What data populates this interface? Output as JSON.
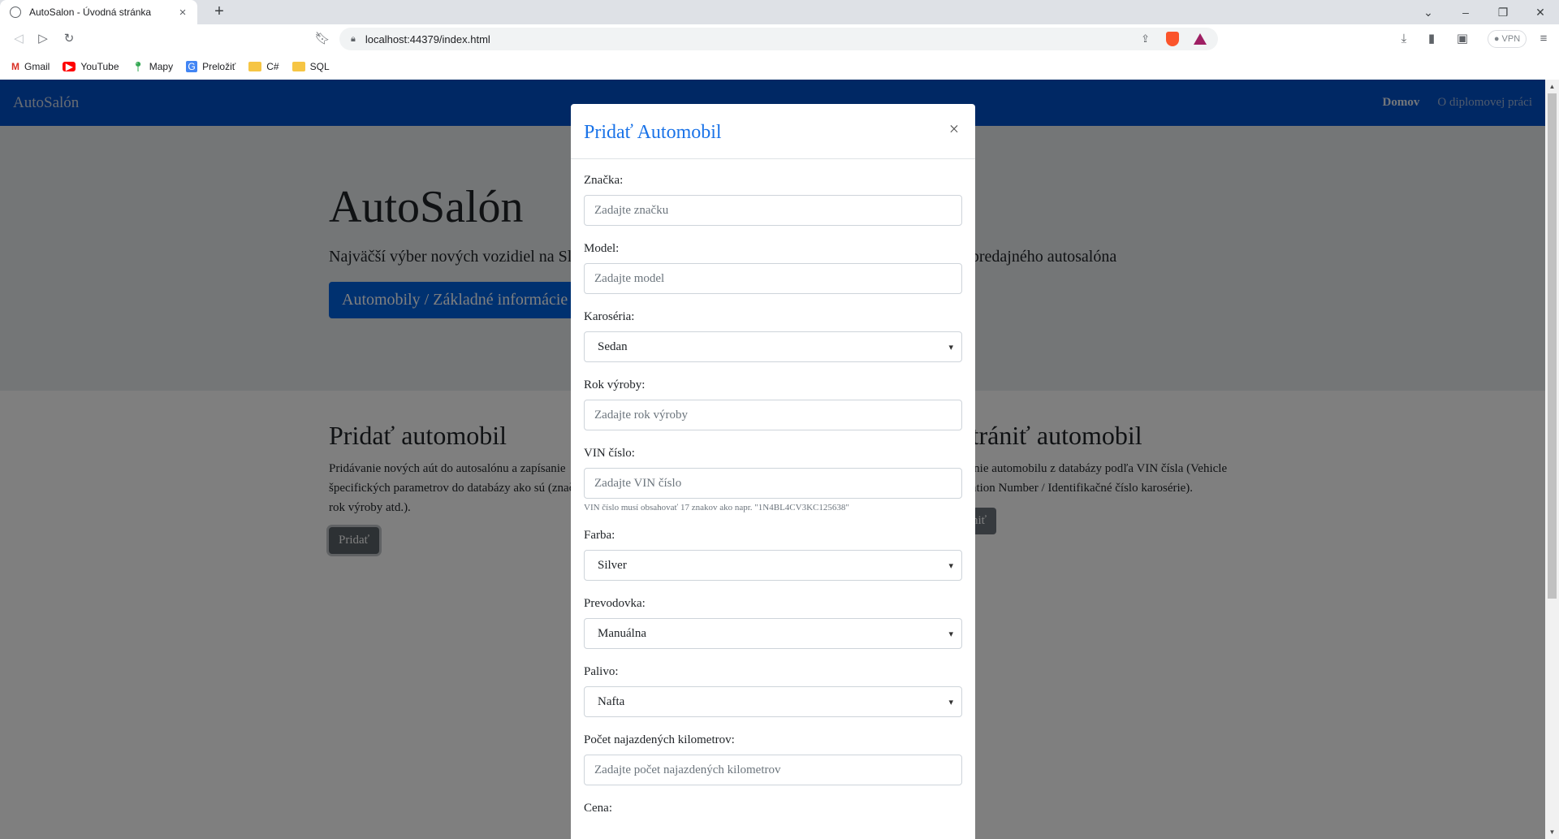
{
  "browser": {
    "tab_title": "AutoSalon - Úvodná stránka",
    "url": "localhost:44379/index.html",
    "vpn_label": "VPN",
    "bookmarks": [
      {
        "label": "Gmail",
        "icon": "gmail-icon"
      },
      {
        "label": "YouTube",
        "icon": "youtube-icon"
      },
      {
        "label": "Mapy",
        "icon": "maps-icon"
      },
      {
        "label": "Preložiť",
        "icon": "translate-icon"
      },
      {
        "label": "C#",
        "icon": "folder-icon"
      },
      {
        "label": "SQL",
        "icon": "folder-icon"
      }
    ]
  },
  "navbar": {
    "brand": "AutoSalón",
    "links": [
      "Domov",
      "O diplomovej práci"
    ],
    "color": "#0050c8"
  },
  "jumbotron": {
    "title": "AutoSalón",
    "lead": "Najväčší výber nových vozidiel na Slovensku. Vyhľadajte požadované informácie o automobiloch predajného autosalóna",
    "button": "Automobily / Základné informácie"
  },
  "sections": {
    "add": {
      "title": "Pridať automobil",
      "text": "Pridávanie nových aút do autosalónu a zapísanie špecifických parametrov do databázy ako sú (značka, typ, rok výroby atd.).",
      "button": "Pridať"
    },
    "remove": {
      "title": "Odstrániť automobil",
      "text": "Odstránenie automobilu z databázy podľa VIN čísla (Vehicle Identification Number / Identifikačné číslo karosérie).",
      "button": "Odstrániť"
    }
  },
  "modal": {
    "title": "Pridať Automobil",
    "close": "×",
    "fields": {
      "brand": {
        "label": "Značka:",
        "placeholder": "Zadajte značku"
      },
      "model": {
        "label": "Model:",
        "placeholder": "Zadajte model"
      },
      "body": {
        "label": "Karoséria:",
        "value": "Sedan"
      },
      "year": {
        "label": "Rok výroby:",
        "placeholder": "Zadajte rok výroby"
      },
      "vin": {
        "label": "VIN číslo:",
        "placeholder": "Zadajte VIN číslo",
        "help": "VIN číslo musí obsahovať 17 znakov ako napr. \"1N4BL4CV3KC125638\""
      },
      "color": {
        "label": "Farba:",
        "value": "Silver"
      },
      "transmission": {
        "label": "Prevodovka:",
        "value": "Manuálna"
      },
      "fuel": {
        "label": "Palivo:",
        "value": "Nafta"
      },
      "mileage": {
        "label": "Počet najazdených kilometrov:",
        "placeholder": "Zadajte počet najazdených kilometrov"
      },
      "price": {
        "label": "Cena:"
      }
    }
  }
}
